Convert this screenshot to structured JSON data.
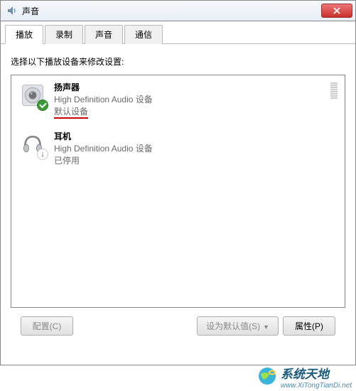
{
  "title_icon": "volume-icon",
  "title": "声音",
  "close_label": "×",
  "tabs": [
    {
      "label": "播放",
      "active": true
    },
    {
      "label": "录制",
      "active": false
    },
    {
      "label": "声音",
      "active": false
    },
    {
      "label": "通信",
      "active": false
    }
  ],
  "instruction": "选择以下播放设备来修改设置:",
  "devices": [
    {
      "icon": "speaker-icon",
      "badge": "default-check",
      "name": "扬声器",
      "desc": "High Definition Audio 设备",
      "status": "默认设备",
      "status_highlight": true,
      "has_meter": true,
      "selected": false
    },
    {
      "icon": "headphones-icon",
      "badge": "arrow-down",
      "name": "耳机",
      "desc": "High Definition Audio 设备",
      "status": "已停用",
      "status_highlight": false,
      "has_meter": false,
      "selected": false
    }
  ],
  "buttons": {
    "configure": "配置(C)",
    "set_default": "设为默认值(S)",
    "properties": "属性(P)"
  },
  "watermark": {
    "main": "系统天地",
    "sub": "www.XiTongTianDi.net"
  }
}
